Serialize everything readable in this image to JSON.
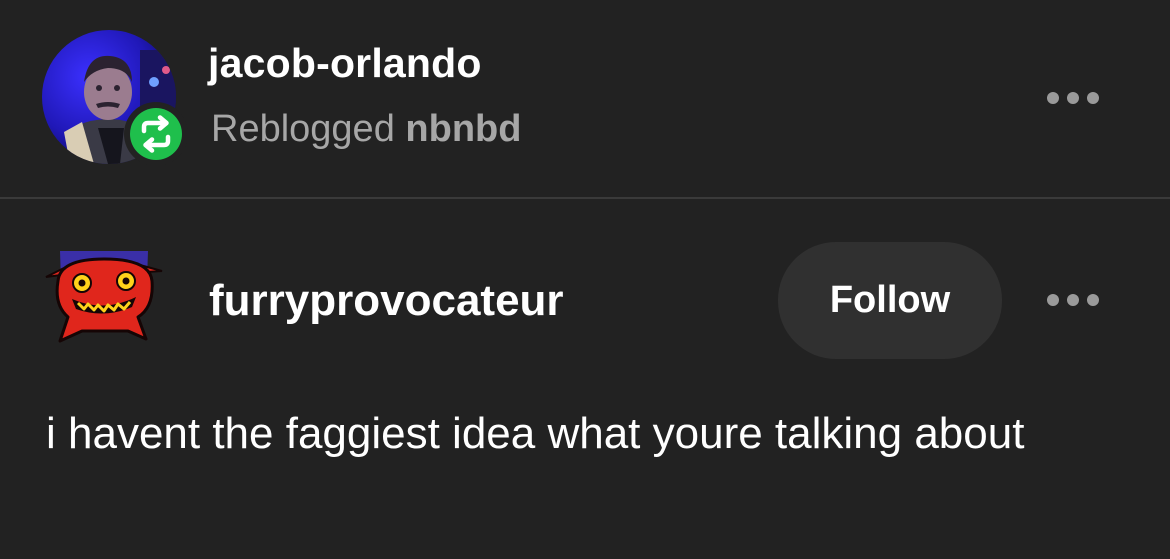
{
  "reblog": {
    "reblogger_name": "jacob-orlando",
    "reblogged_label": "Reblogged",
    "from_blog": "nbnbd",
    "avatar_icon": "user-avatar-photo",
    "badge_icon": "reblog-icon",
    "badge_color": "#1fbf4c",
    "menu_icon": "more-options-icon"
  },
  "post": {
    "author_name": "furryprovocateur",
    "author_avatar_icon": "red-creature-avatar",
    "follow_label": "Follow",
    "menu_icon": "more-options-icon",
    "body_text": "i havent the faggiest idea what youre talking about"
  },
  "colors": {
    "background": "#222222",
    "primary_text": "#ffffff",
    "secondary_text": "#a7a7a7",
    "follow_button_bg": "#303030"
  }
}
